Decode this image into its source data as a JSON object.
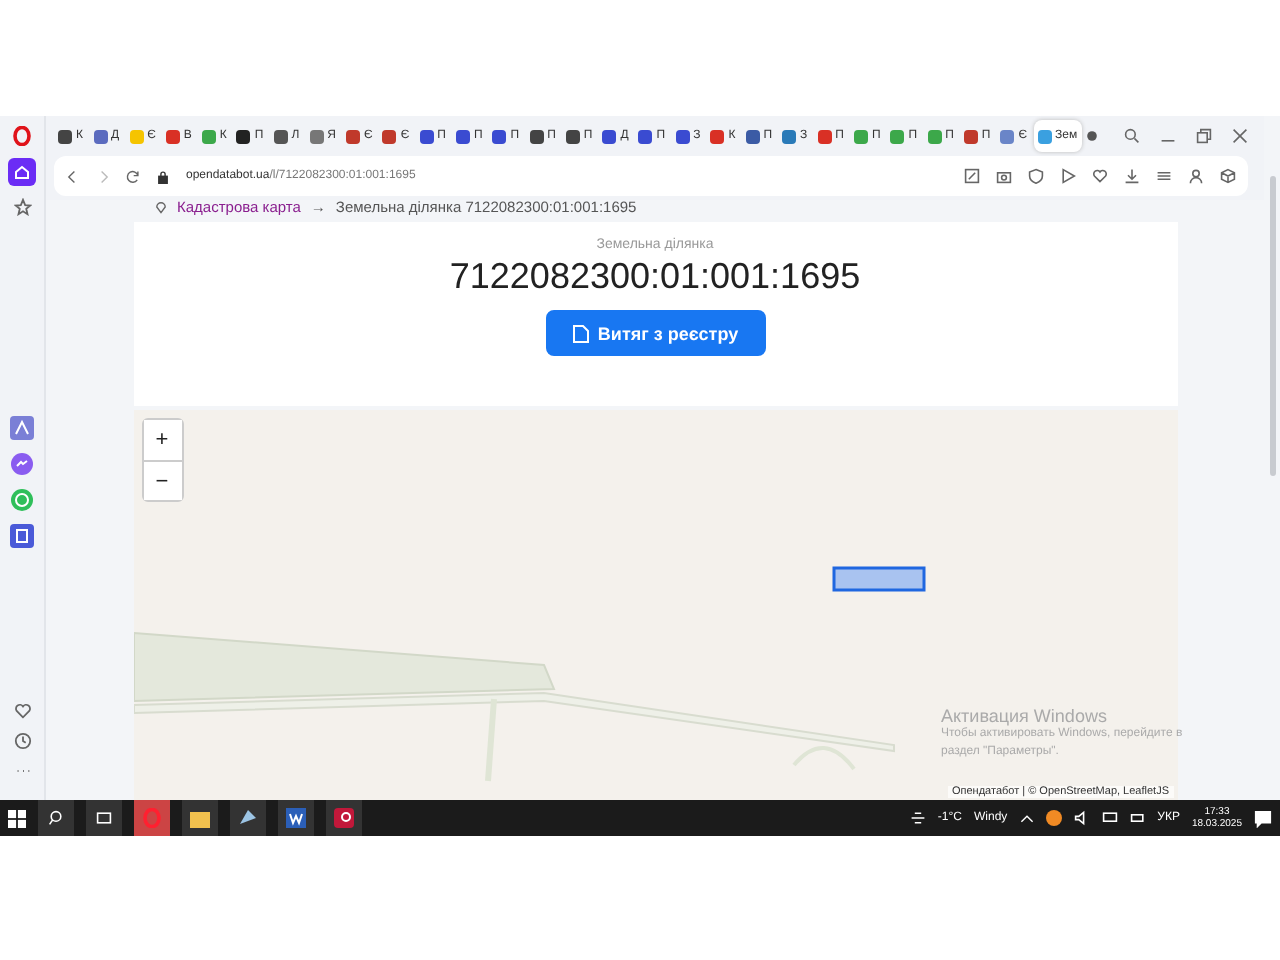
{
  "tabs": [
    {
      "label": "К",
      "color": "#444444",
      "selected": false
    },
    {
      "label": "Д",
      "color": "#5b6bbf",
      "selected": false
    },
    {
      "label": "Є",
      "color": "#f5c400",
      "selected": false
    },
    {
      "label": "В",
      "color": "#d93025",
      "selected": false
    },
    {
      "label": "К",
      "color": "#3ca84a",
      "selected": false
    },
    {
      "label": "П",
      "color": "#222222",
      "selected": false
    },
    {
      "label": "Л",
      "color": "#555555",
      "selected": false
    },
    {
      "label": "Я",
      "color": "#777777",
      "selected": false
    },
    {
      "label": "Є",
      "color": "#c0392b",
      "selected": false
    },
    {
      "label": "Є",
      "color": "#c0392b",
      "selected": false
    },
    {
      "label": "П",
      "color": "#3a4bd1",
      "selected": false
    },
    {
      "label": "П",
      "color": "#3a4bd1",
      "selected": false
    },
    {
      "label": "П",
      "color": "#3a4bd1",
      "selected": false
    },
    {
      "label": "П",
      "color": "#444444",
      "selected": false
    },
    {
      "label": "П",
      "color": "#444444",
      "selected": false
    },
    {
      "label": "Д",
      "color": "#3a4bd1",
      "selected": false
    },
    {
      "label": "П",
      "color": "#3a4bd1",
      "selected": false
    },
    {
      "label": "З",
      "color": "#3a4bd1",
      "selected": false
    },
    {
      "label": "К",
      "color": "#d93025",
      "selected": false
    },
    {
      "label": "П",
      "color": "#3b5ba5",
      "selected": false
    },
    {
      "label": "З",
      "color": "#2a7ab8",
      "selected": false
    },
    {
      "label": "П",
      "color": "#d93025",
      "selected": false
    },
    {
      "label": "П",
      "color": "#3ca84a",
      "selected": false
    },
    {
      "label": "П",
      "color": "#3ca84a",
      "selected": false
    },
    {
      "label": "П",
      "color": "#3ca84a",
      "selected": false
    },
    {
      "label": "П",
      "color": "#c0392b",
      "selected": false
    },
    {
      "label": "Є",
      "color": "#6a85c8",
      "selected": false
    },
    {
      "label": "Зем",
      "color": "#3aa0e0",
      "selected": true
    }
  ],
  "address": {
    "host": "opendatabot.ua",
    "path": "/l/7122082300:01:001:1695"
  },
  "breadcrumb": {
    "link": "Кадастрова карта",
    "separator": "→",
    "current": "Земельна ділянка 7122082300:01:001:1695"
  },
  "card": {
    "subtitle": "Земельна ділянка",
    "title": "7122082300:01:001:1695",
    "button": "Витяг з реєстру"
  },
  "map": {
    "zoom_in": "+",
    "zoom_out": "−",
    "attribution": "Опендатабот | © OpenStreetMap, LeafletJS"
  },
  "activation": {
    "title": "Активация Windows",
    "text": "Чтобы активировать Windows, перейдите в раздел \"Параметры\"."
  },
  "taskbar": {
    "temperature": "-1°C",
    "weather": "Windy",
    "language": "УКР",
    "time": "17:33",
    "date": "18.03.2025"
  }
}
